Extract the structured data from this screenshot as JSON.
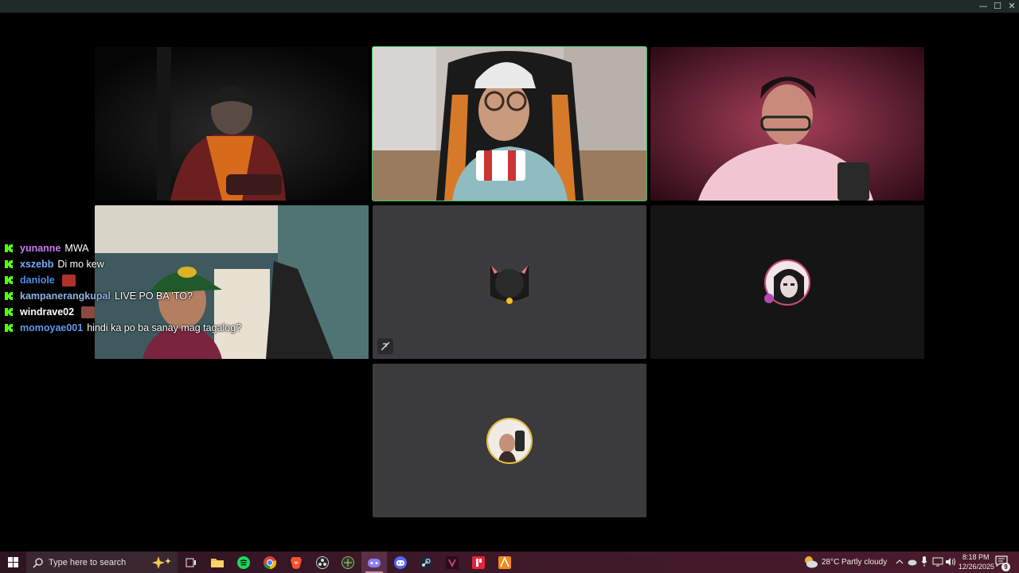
{
  "window": {
    "minimize_glyph": "—",
    "maximize_glyph": "☐",
    "close_glyph": "✕"
  },
  "tiles": [
    {
      "id": "tile-top-left",
      "type": "camera",
      "speaking": false
    },
    {
      "id": "tile-top-center",
      "type": "camera",
      "speaking": true
    },
    {
      "id": "tile-top-right",
      "type": "camera",
      "speaking": false
    },
    {
      "id": "tile-middle-left",
      "type": "camera",
      "speaking": false
    },
    {
      "id": "tile-middle-center",
      "type": "avatar",
      "avatar": "black-cat-avatar",
      "muted": true
    },
    {
      "id": "tile-middle-right",
      "type": "avatar",
      "avatar": "pixel-art-avatar",
      "muted": false
    },
    {
      "id": "tile-bottom-center",
      "type": "avatar",
      "avatar": "photo-avatar",
      "muted": false
    }
  ],
  "chat": {
    "messages": [
      {
        "user": "yunanne",
        "color": "#c77df0",
        "text": "MWA",
        "emote": false
      },
      {
        "user": "xszebb",
        "color": "#7aa9ff",
        "text": "Di mo kew",
        "emote": false
      },
      {
        "user": "daniole",
        "color": "#4b8eea",
        "text": "",
        "emote": true
      },
      {
        "user": "kampanerangkupal",
        "color": "#8fb4e6",
        "text": "LIVE PO BA 'TO?",
        "emote": false
      },
      {
        "user": "windrave02",
        "color": "#ffffff",
        "text": "",
        "emote": true
      },
      {
        "user": "momoyae001",
        "color": "#5f9ae8",
        "text": "hindi ka po ba sanay mag tagalog?",
        "emote": false
      }
    ],
    "icon_color": "#53fc18"
  },
  "taskbar": {
    "search_placeholder": "Type here to search",
    "apps": [
      "windows-start-icon",
      "task-view-icon",
      "file-explorer-icon",
      "spotify-icon",
      "chrome-icon",
      "brave-icon",
      "obs-icon",
      "app-icon",
      "discord-ptb-icon",
      "discord-icon",
      "steam-icon",
      "vegas-icon",
      "creative-app-icon",
      "illustrator-icon"
    ],
    "weather": {
      "temp": "28°C",
      "condition": "Partly cloudy"
    },
    "time": "8:18 PM",
    "date": "12/26/2025",
    "notification_count": "9"
  }
}
